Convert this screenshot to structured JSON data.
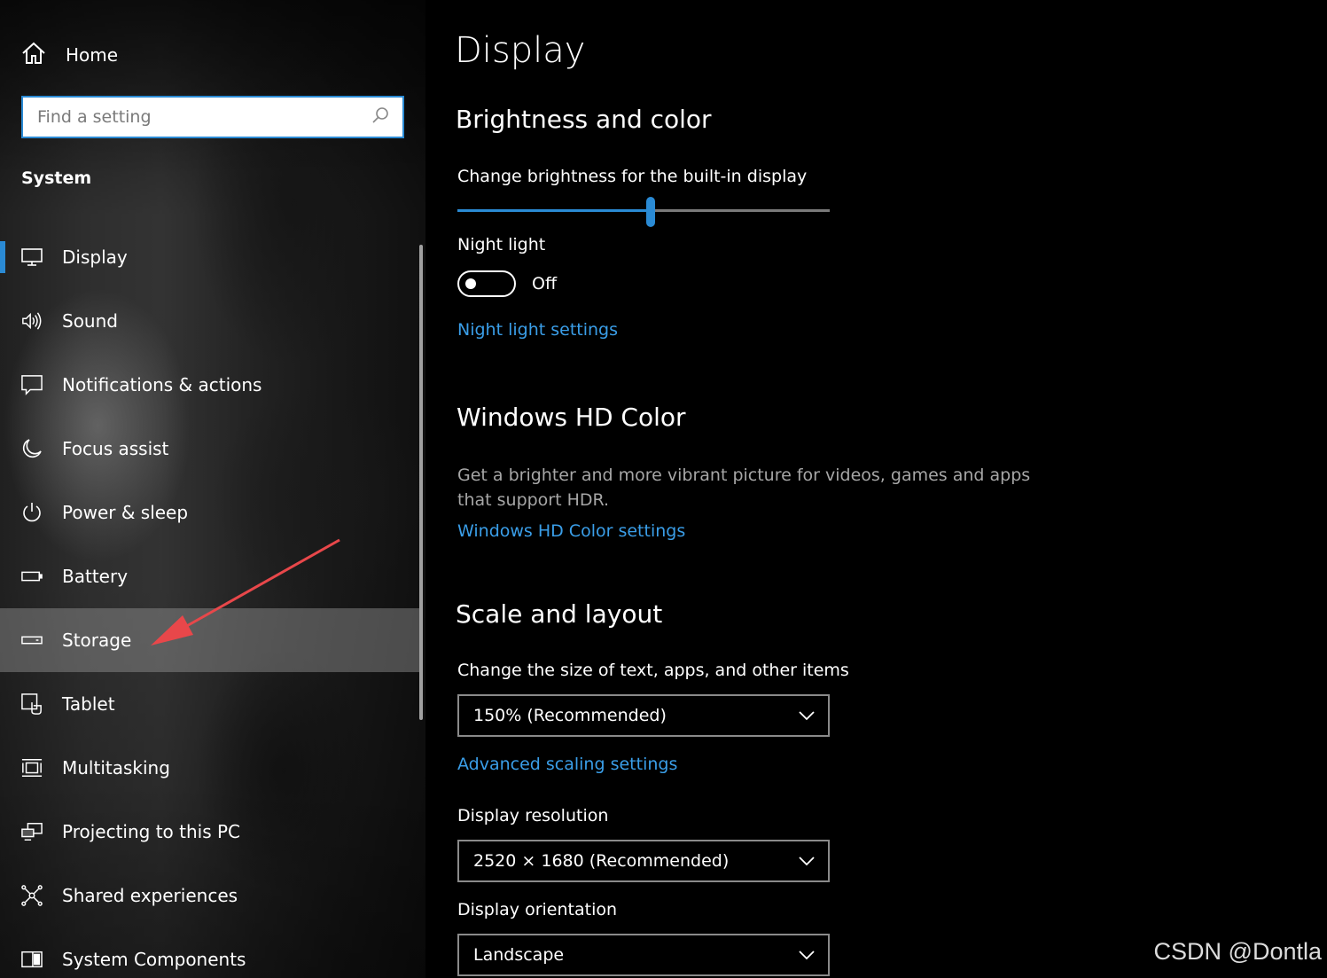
{
  "sidebar": {
    "home_label": "Home",
    "search_placeholder": "Find a setting",
    "section_title": "System",
    "items": [
      {
        "label": "Display",
        "icon": "monitor-icon"
      },
      {
        "label": "Sound",
        "icon": "speaker-icon"
      },
      {
        "label": "Notifications & actions",
        "icon": "notification-icon"
      },
      {
        "label": "Focus assist",
        "icon": "moon-icon"
      },
      {
        "label": "Power & sleep",
        "icon": "power-icon"
      },
      {
        "label": "Battery",
        "icon": "battery-icon"
      },
      {
        "label": "Storage",
        "icon": "storage-icon"
      },
      {
        "label": "Tablet",
        "icon": "tablet-icon"
      },
      {
        "label": "Multitasking",
        "icon": "multitasking-icon"
      },
      {
        "label": "Projecting to this PC",
        "icon": "projecting-icon"
      },
      {
        "label": "Shared experiences",
        "icon": "shared-icon"
      },
      {
        "label": "System Components",
        "icon": "components-icon"
      }
    ],
    "selected": "Display",
    "hovered": "Storage"
  },
  "main": {
    "title": "Display",
    "brightness": {
      "heading": "Brightness and color",
      "slider_label": "Change brightness for the built-in display",
      "brightness_fraction": 0.52
    },
    "night_light": {
      "label": "Night light",
      "state_text": "Off",
      "settings_link": "Night light settings"
    },
    "hd_color": {
      "heading": "Windows HD Color",
      "description": "Get a brighter and more vibrant picture for videos, games and apps that support HDR.",
      "settings_link": "Windows HD Color settings"
    },
    "scale_layout": {
      "heading": "Scale and layout",
      "size_label": "Change the size of text, apps, and other items",
      "size_value": "150% (Recommended)",
      "advanced_link": "Advanced scaling settings",
      "resolution_label": "Display resolution",
      "resolution_value": "2520 × 1680 (Recommended)",
      "orientation_label": "Display orientation",
      "orientation_value": "Landscape"
    }
  },
  "watermark": "CSDN @Dontla",
  "colors": {
    "accent": "#2a8ad4",
    "link": "#3a9ee8",
    "annotation_arrow": "#e8474a"
  }
}
